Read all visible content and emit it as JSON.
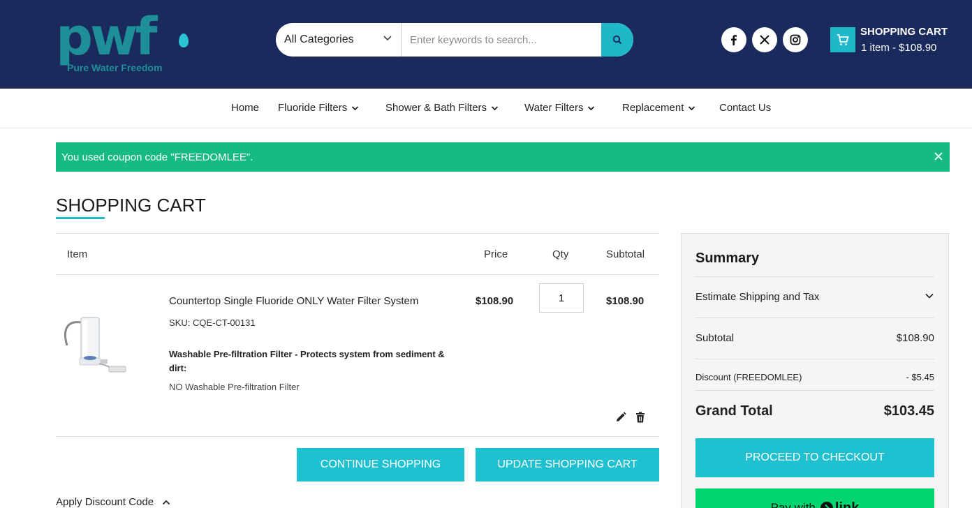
{
  "header": {
    "logo_text": "pwf",
    "logo_subtitle": "Pure Water Freedom",
    "search": {
      "category_label": "All Categories",
      "placeholder": "Enter keywords to search..."
    },
    "social": [
      "facebook-icon",
      "x-twitter-icon",
      "instagram-icon"
    ],
    "cart": {
      "title": "SHOPPING CART",
      "summary": "1 item - $108.90"
    }
  },
  "nav": {
    "items": [
      {
        "label": "Home"
      },
      {
        "label": "Fluoride Filters"
      },
      {
        "label": "Shower & Bath Filters"
      },
      {
        "label": "Water Filters"
      },
      {
        "label": "Replacement"
      },
      {
        "label": "Contact Us"
      }
    ]
  },
  "notice": {
    "text": "You used coupon code \"FREEDOMLEE\"."
  },
  "page": {
    "title": "SHOPPING CART"
  },
  "cart": {
    "headers": {
      "item": "Item",
      "price": "Price",
      "qty": "Qty",
      "subtotal": "Subtotal"
    },
    "items": [
      {
        "name": "Countertop Single Fluoride ONLY Water Filter System",
        "sku": "SKU: CQE-CT-00131",
        "option_label": "Washable Pre-filtration Filter - Protects system from sediment & dirt:",
        "option_value": "NO Washable Pre-filtration Filter",
        "price": "$108.90",
        "qty": "1",
        "subtotal": "$108.90"
      }
    ],
    "continue_label": "CONTINUE SHOPPING",
    "update_label": "UPDATE SHOPPING CART",
    "discount_label": "Apply Discount Code"
  },
  "summary": {
    "title": "Summary",
    "shipping_label": "Estimate Shipping and Tax",
    "subtotal_label": "Subtotal",
    "subtotal_value": "$108.90",
    "discount_label": "Discount (FREEDOMLEE)",
    "discount_value": "- $5.45",
    "grand_label": "Grand Total",
    "grand_value": "$103.45",
    "checkout_label": "PROCEED TO CHECKOUT",
    "paylink_prefix": "Pay with",
    "paylink_brand": "link"
  },
  "colors": {
    "header_bg": "#1b2a5c",
    "accent": "#1fc0cf",
    "success": "#15bb83",
    "link_green": "#00d66f"
  }
}
